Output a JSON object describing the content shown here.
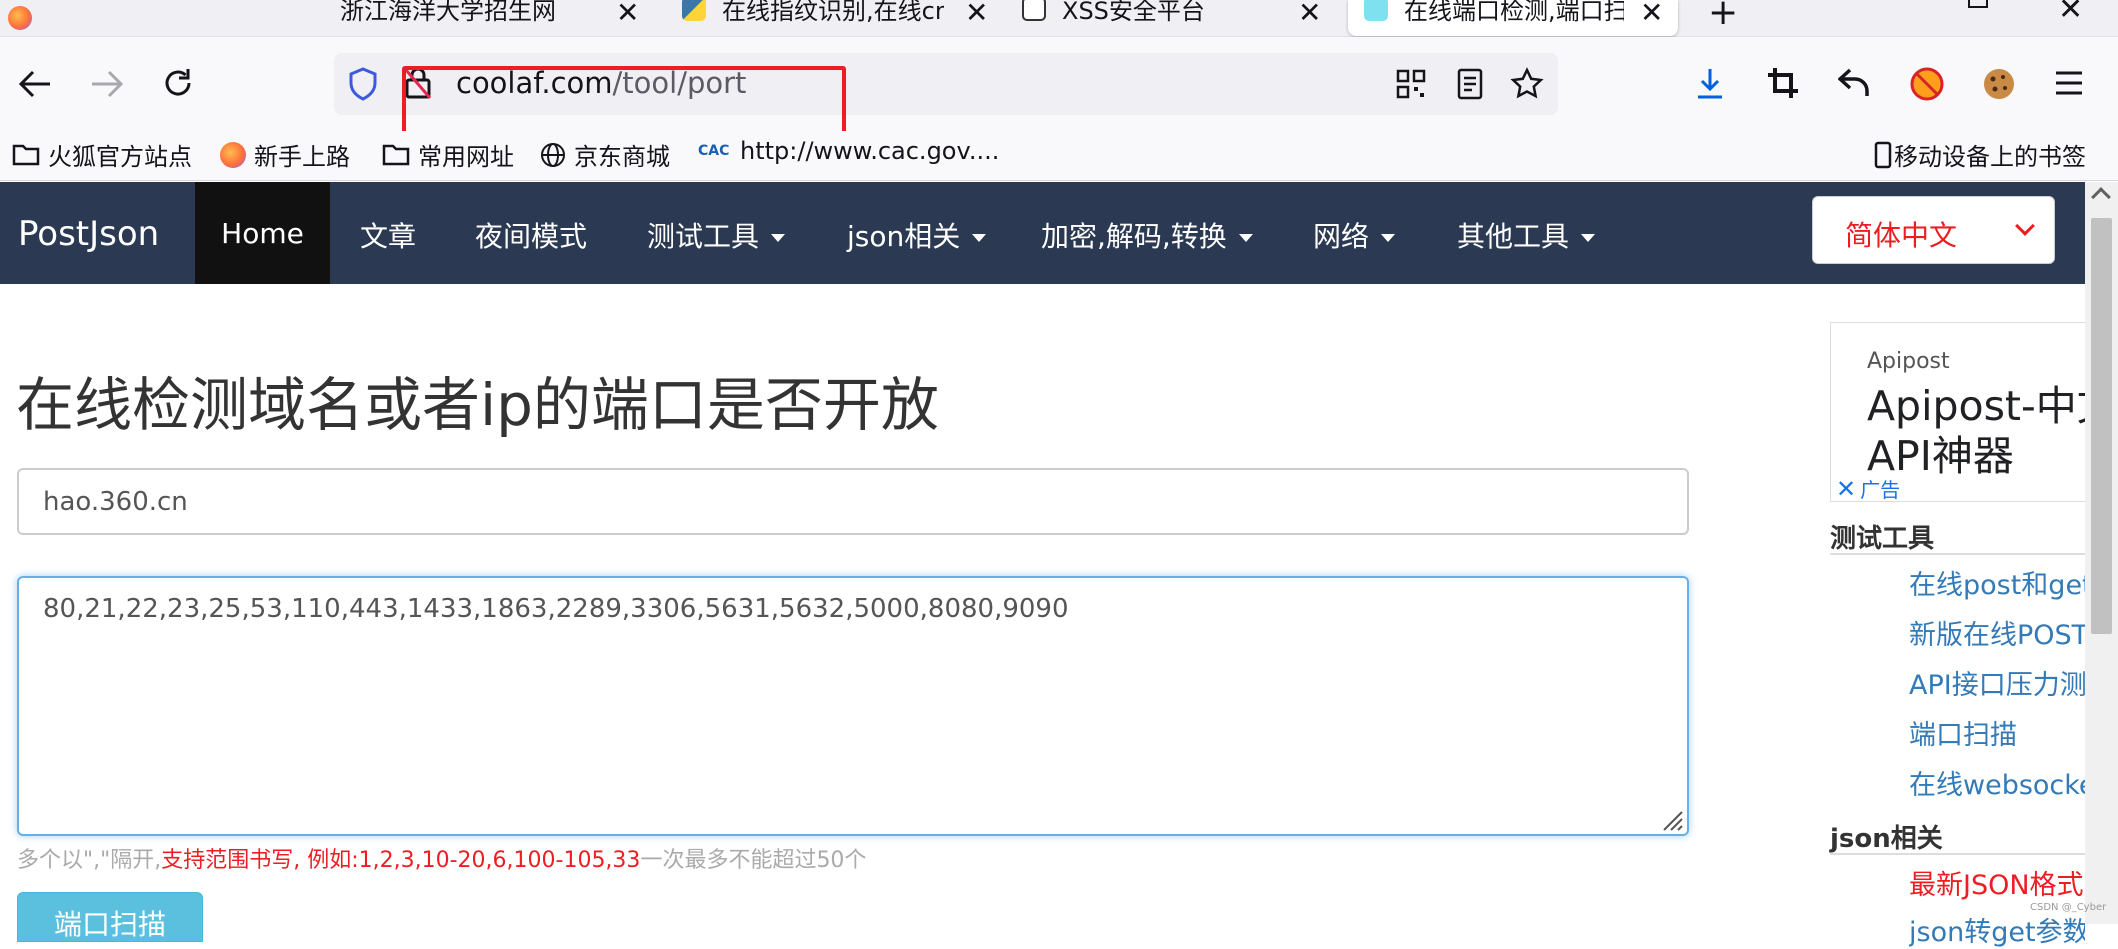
{
  "browser": {
    "tabs": [
      {
        "title": "浙江海洋大学招生网"
      },
      {
        "title": "在线指纹识别,在线cms"
      },
      {
        "title": "XSS安全平台"
      },
      {
        "title": "在线端口检测,端口扫描"
      }
    ],
    "new_tab_icon": "plus-icon",
    "url": {
      "host": "coolaf.com",
      "path": "/tool/port"
    },
    "bookmarks": [
      {
        "label": "火狐官方站点",
        "icon": "folder-icon"
      },
      {
        "label": "新手上路",
        "icon": "firefox-icon"
      },
      {
        "label": "常用网址",
        "icon": "folder-icon"
      },
      {
        "label": "京东商城",
        "icon": "globe-icon"
      },
      {
        "label": "http://www.cac.gov....",
        "icon": "cac-icon"
      }
    ],
    "mobile_bookmarks": "移动设备上的书签"
  },
  "site": {
    "brand": "PostJson",
    "nav": {
      "home": "Home",
      "articles": "文章",
      "night_mode": "夜间模式",
      "test_tools": "测试工具",
      "json": "json相关",
      "encode": "加密,解码,转换",
      "network": "网络",
      "other": "其他工具"
    },
    "language": "简体中文"
  },
  "main": {
    "title": "在线检测域名或者ip的端口是否开放",
    "host_value": "hao.360.cn",
    "ports_value": "80,21,22,23,25,53,110,443,1433,1863,2289,3306,5631,5632,5000,8080,9090",
    "help_prefix": "多个以\",\"隔开,",
    "help_red": "支持范围书写, 例如:1,2,3,10-20,6,100-105,33",
    "help_suffix": "一次最多不能超过50个",
    "scan_button": "端口扫描"
  },
  "sidebar": {
    "ad_brand": "Apipost",
    "ad_title_line1": "Apipost-中文版",
    "ad_title_line2": "API神器",
    "ad_label": "广告",
    "section_test_tools": "测试工具",
    "test_links": [
      "在线post和get",
      "新版在线POST",
      "API接口压力测",
      "端口扫描",
      "在线websocket"
    ],
    "section_json": "json相关",
    "json_links": [
      "最新JSON格式",
      "json转get参数"
    ]
  },
  "watermark": "CSDN @_Cyber",
  "colors": {
    "nav_bg": "#2b3a52",
    "home_bg": "#111111",
    "accent_red": "#ee1d23",
    "link_blue": "#337ab7",
    "button_blue": "#5bc0de",
    "focus_blue": "#66afe9"
  }
}
